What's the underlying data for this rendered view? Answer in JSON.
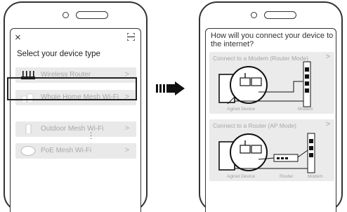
{
  "left_screen": {
    "title": "Select your device type",
    "items": [
      {
        "label": "Wireless Router",
        "icon": "router-icon"
      },
      {
        "label": "Whole Home Mesh Wi-Fi",
        "icon": "mesh-unit-icon"
      },
      {
        "label": "Outdoor Mesh Wi-Fi",
        "icon": "outdoor-unit-icon"
      },
      {
        "label": "PoE Mesh Wi-Fi",
        "icon": "poe-unit-icon"
      }
    ],
    "chevron": ">",
    "close": "×",
    "highlighted_item": "Whole Home Mesh Wi-Fi"
  },
  "right_screen": {
    "title": "How will you connect your device to the internet?",
    "options": [
      {
        "label": "Connect to a Modem (Router Mode)",
        "labels": [
          "Aginet Device",
          "Modem"
        ]
      },
      {
        "label": "Connect to a Router (AP Mode)",
        "labels": [
          "Aginet Device",
          "Router",
          "Modem"
        ]
      }
    ],
    "chevron": ">"
  },
  "colors": {
    "outline": "#333333",
    "item_bg": "#e9e9e9",
    "item_text": "#a8a8a8",
    "arrow": "#111111"
  }
}
